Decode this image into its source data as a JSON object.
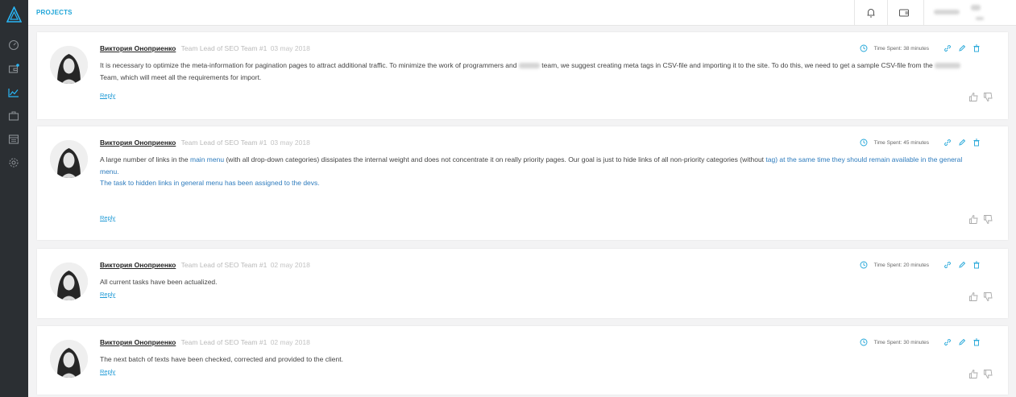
{
  "header": {
    "title": "PROJECTS"
  },
  "sidebar": {
    "items": [
      "dashboard-icon",
      "wallet-icon",
      "chart-icon",
      "briefcase-icon",
      "calendar-icon",
      "settings-icon"
    ]
  },
  "colors": {
    "accent": "#1fa5d8",
    "sidebar_bg": "#2b2f33",
    "link": "#2d7bbd"
  },
  "comments": [
    {
      "author": "Виктория Оноприенко",
      "role": "Team Lead of SEO Team #1",
      "date": "03 may 2018",
      "time_spent": "Time Spent: 38 minutes",
      "p1": "It is necessary to optimize the meta-information for pagination pages to attract additional traffic. To minimize the work of programmers and",
      "p2": "team, we suggest creating meta tags in CSV-file and importing it to the site. To do this, we need to get a sample CSV-file from the",
      "p3": "Team, which will meet all the requirements for import.",
      "reply": "Reply"
    },
    {
      "author": "Виктория Оноприенко",
      "role": "Team Lead of SEO Team #1",
      "date": "03 may 2018",
      "time_spent": "Time Spent: 45 minutes",
      "p1": "A large number of links in the",
      "link1": "main menu",
      "p2": "(with all drop-down categories) dissipates the internal weight and does not concentrate it on really priority pages. Our goal is just to hide links of all non-priority categories (without",
      "link2": "tag) at the same time they should remain available in the",
      "link3": "general menu.",
      "p3": "The task to hidden links in general menu has been assigned to the devs.",
      "reply": "Reply"
    },
    {
      "author": "Виктория Оноприенко",
      "role": "Team Lead of SEO Team #1",
      "date": "02 may 2018",
      "time_spent": "Time Spent: 20 minutes",
      "p1": "All current tasks have been actualized.",
      "reply": "Reply"
    },
    {
      "author": "Виктория Оноприенко",
      "role": "Team Lead of SEO Team #1",
      "date": "02 may 2018",
      "time_spent": "Time Spent: 30 minutes",
      "p1": "The next batch of texts have been checked, corrected and provided to the client.",
      "reply": "Reply"
    }
  ]
}
